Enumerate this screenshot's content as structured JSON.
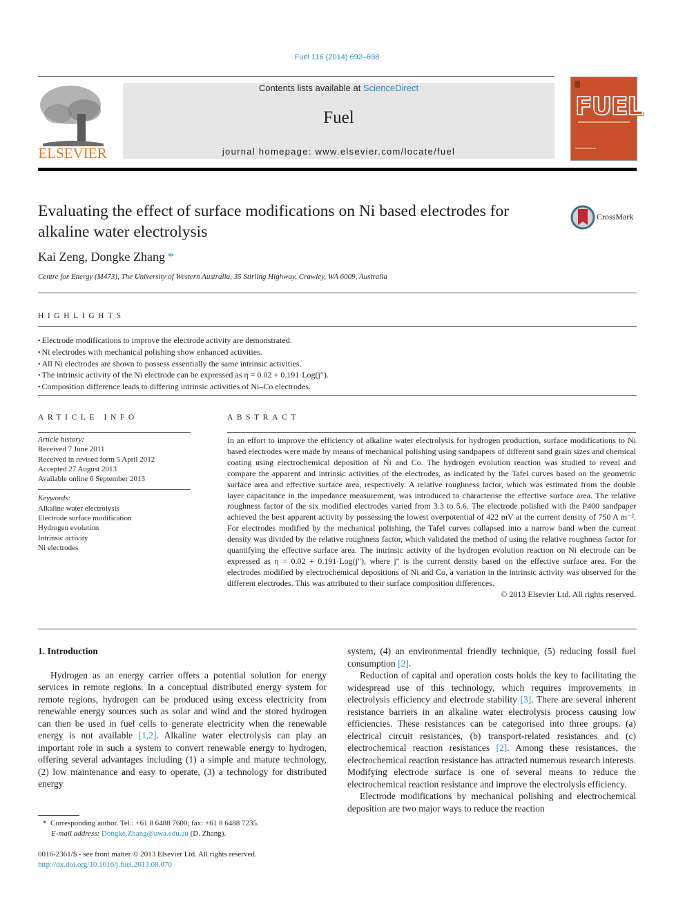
{
  "header": {
    "citation": "Fuel 116 (2014) 692–698",
    "contents_prefix": "Contents lists available at ",
    "contents_link": "ScienceDirect",
    "journal_name": "Fuel",
    "homepage": "journal homepage: www.elsevier.com/locate/fuel",
    "publisher": "ELSEVIER",
    "cover_title": "FUEL",
    "crossmark_label": "CrossMark"
  },
  "article": {
    "title": "Evaluating the effect of surface modifications on Ni based electrodes for alkaline water electrolysis",
    "authors": "Kai Zeng, Dongke Zhang",
    "author_mark": "*",
    "affiliation": "Centre for Energy (M473), The University of Western Australia, 35 Stirling Highway, Crawley, WA 6009, Australia"
  },
  "highlights": {
    "heading": "HIGHLIGHTS",
    "items": [
      "Electrode modifications to improve the electrode activity are demonstrated.",
      "Ni electrodes with mechanical polishing show enhanced activities.",
      "All Ni electrodes are shown to possess essentially the same intrinsic activities.",
      "The intrinsic activity of the Ni electrode can be expressed as η = 0.02 + 0.191·Log(j″).",
      "Composition difference leads to differing intrinsic activities of Ni–Co electrodes."
    ]
  },
  "article_info": {
    "heading": "ARTICLE INFO",
    "history_label": "Article history:",
    "history": [
      "Received 7 June 2011",
      "Received in revised form 5 April 2012",
      "Accepted 27 August 2013",
      "Available online 6 September 2013"
    ],
    "keywords_label": "Keywords:",
    "keywords": [
      "Alkaline water electrolysis",
      "Electrode surface modification",
      "Hydrogen evolution",
      "Intrinsic activity",
      "Ni electrodes"
    ]
  },
  "abstract": {
    "heading": "ABSTRACT",
    "text": "In an effort to improve the efficiency of alkaline water electrolysis for hydrogen production, surface modifications to Ni based electrodes were made by means of mechanical polishing using sandpapers of different sand grain sizes and chemical coating using electrochemical deposition of Ni and Co. The hydrogen evolution reaction was studied to reveal and compare the apparent and intrinsic activities of the electrodes, as indicated by the Tafel curves based on the geometric surface area and effective surface area, respectively. A relative roughness factor, which was estimated from the double layer capacitance in the impedance measurement, was introduced to characterise the effective surface area. The relative roughness factor of the six modified electrodes varied from 3.3 to 5.6. The electrode polished with the P400 sandpaper achieved the best apparent activity by possessing the lowest overpotential of 422 mV at the current density of 750 A m⁻². For electrodes modified by the mechanical polishing, the Tafel curves collapsed into a narrow band when the current density was divided by the relative roughness factor, which validated the method of using the relative roughness factor for quantifying the effective surface area. The intrinsic activity of the hydrogen evolution reaction on Ni electrode can be expressed as η = 0.02 + 0.191·Log(j″), where j″ is the current density based on the effective surface area. For the electrodes modified by electrochemical depositions of Ni and Co, a variation in the intrinsic activity was observed for the different electrodes. This was attributed to their surface composition differences.",
    "copyright": "© 2013 Elsevier Ltd. All rights reserved."
  },
  "body": {
    "intro_heading": "1. Introduction",
    "p1_a": "Hydrogen as an energy carrier offers a potential solution for energy services in remote regions. In a conceptual distributed energy system for remote regions, hydrogen can be produced using excess electricity from renewable energy sources such as solar and wind and the stored hydrogen can then be used in fuel cells to generate electricity when the renewable energy is not available ",
    "p1_ref": "[1,2]",
    "p1_b": ". Alkaline water electrolysis can play an important role in such a system to convert renewable energy to hydrogen, offering several advantages including (1) a simple and mature technology, (2) low maintenance and easy to operate, (3) a technology for distributed energy",
    "p1_c": "system, (4) an environmental friendly technique, (5) reducing fossil fuel consumption ",
    "p1_ref2": "[2]",
    "p1_d": ".",
    "p2_a": "Reduction of capital and operation costs holds the key to facilitating the widespread use of this technology, which requires improvements in electrolysis efficiency and electrode stability ",
    "p2_ref": "[3]",
    "p2_b": ". There are several inherent resistance barriers in an alkaline water electrolysis process causing low efficiencies. These resistances can be categorised into three groups. (a) electrical circuit resistances, (b) transport-related resistances and (c) electrochemical reaction resistances ",
    "p2_ref2": "[2]",
    "p2_c": ". Among these resistances, the electrochemical reaction resistance has attracted numerous research interests. Modifying electrode surface is one of several means to reduce the electrochemical reaction resistance and improve the electrolysis efficiency.",
    "p3": "Electrode modifications by mechanical polishing and electrochemical deposition are two major ways to reduce the reaction"
  },
  "footnote": {
    "mark": "*",
    "corresponding": "Corresponding author. Tel.: +61 8 6488 7600; fax: +61 8 6488 7235.",
    "email_label": "E-mail address:",
    "email": "Dongke.Zhang@uwa.edu.au",
    "email_suffix": " (D. Zhang)."
  },
  "front_matter": {
    "issn": "0016-2361/$ - see front matter © 2013 Elsevier Ltd. All rights reserved.",
    "doi": "http://dx.doi.org/10.1016/j.fuel.2013.08.070"
  },
  "colors": {
    "link": "#2a8fc1",
    "elsevier_orange": "#e87722",
    "cover": "#c9502a",
    "banner_bg": "#e6e6e6"
  }
}
